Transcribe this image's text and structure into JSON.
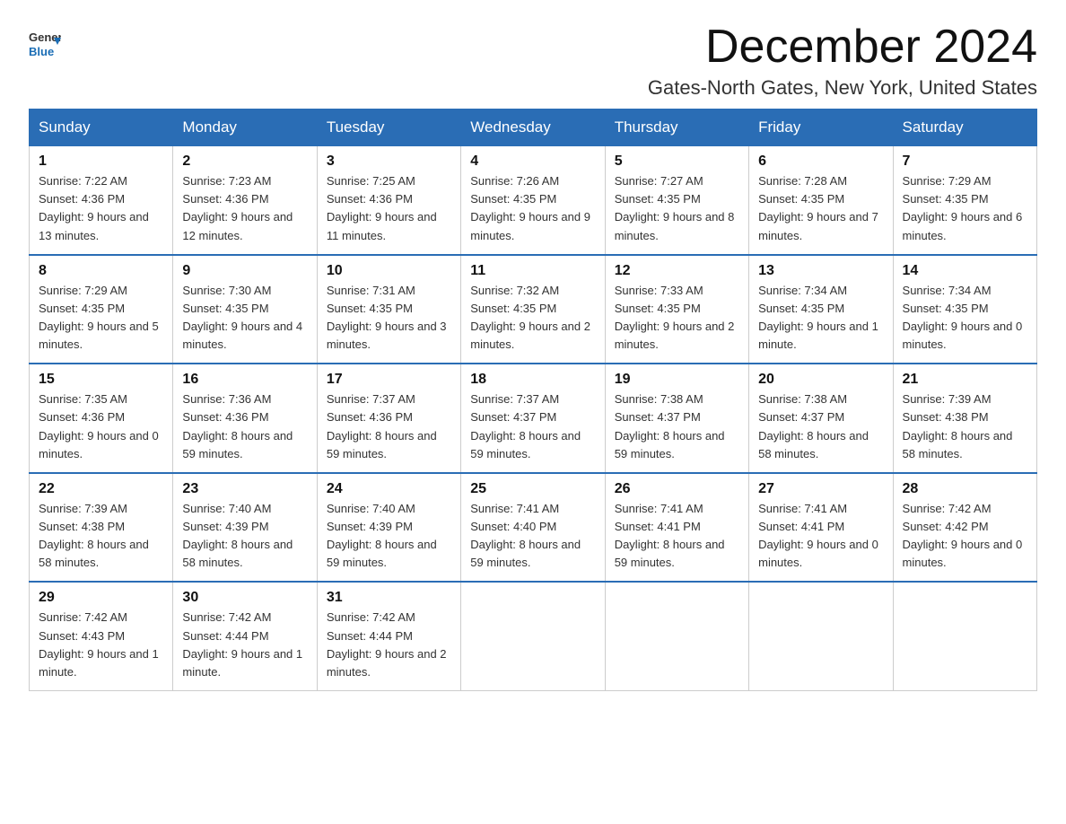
{
  "header": {
    "logo_general": "General",
    "logo_blue": "Blue",
    "month_title": "December 2024",
    "subtitle": "Gates-North Gates, New York, United States"
  },
  "days_of_week": [
    "Sunday",
    "Monday",
    "Tuesday",
    "Wednesday",
    "Thursday",
    "Friday",
    "Saturday"
  ],
  "weeks": [
    [
      {
        "day": "1",
        "sunrise": "7:22 AM",
        "sunset": "4:36 PM",
        "daylight": "9 hours and 13 minutes."
      },
      {
        "day": "2",
        "sunrise": "7:23 AM",
        "sunset": "4:36 PM",
        "daylight": "9 hours and 12 minutes."
      },
      {
        "day": "3",
        "sunrise": "7:25 AM",
        "sunset": "4:36 PM",
        "daylight": "9 hours and 11 minutes."
      },
      {
        "day": "4",
        "sunrise": "7:26 AM",
        "sunset": "4:35 PM",
        "daylight": "9 hours and 9 minutes."
      },
      {
        "day": "5",
        "sunrise": "7:27 AM",
        "sunset": "4:35 PM",
        "daylight": "9 hours and 8 minutes."
      },
      {
        "day": "6",
        "sunrise": "7:28 AM",
        "sunset": "4:35 PM",
        "daylight": "9 hours and 7 minutes."
      },
      {
        "day": "7",
        "sunrise": "7:29 AM",
        "sunset": "4:35 PM",
        "daylight": "9 hours and 6 minutes."
      }
    ],
    [
      {
        "day": "8",
        "sunrise": "7:29 AM",
        "sunset": "4:35 PM",
        "daylight": "9 hours and 5 minutes."
      },
      {
        "day": "9",
        "sunrise": "7:30 AM",
        "sunset": "4:35 PM",
        "daylight": "9 hours and 4 minutes."
      },
      {
        "day": "10",
        "sunrise": "7:31 AM",
        "sunset": "4:35 PM",
        "daylight": "9 hours and 3 minutes."
      },
      {
        "day": "11",
        "sunrise": "7:32 AM",
        "sunset": "4:35 PM",
        "daylight": "9 hours and 2 minutes."
      },
      {
        "day": "12",
        "sunrise": "7:33 AM",
        "sunset": "4:35 PM",
        "daylight": "9 hours and 2 minutes."
      },
      {
        "day": "13",
        "sunrise": "7:34 AM",
        "sunset": "4:35 PM",
        "daylight": "9 hours and 1 minute."
      },
      {
        "day": "14",
        "sunrise": "7:34 AM",
        "sunset": "4:35 PM",
        "daylight": "9 hours and 0 minutes."
      }
    ],
    [
      {
        "day": "15",
        "sunrise": "7:35 AM",
        "sunset": "4:36 PM",
        "daylight": "9 hours and 0 minutes."
      },
      {
        "day": "16",
        "sunrise": "7:36 AM",
        "sunset": "4:36 PM",
        "daylight": "8 hours and 59 minutes."
      },
      {
        "day": "17",
        "sunrise": "7:37 AM",
        "sunset": "4:36 PM",
        "daylight": "8 hours and 59 minutes."
      },
      {
        "day": "18",
        "sunrise": "7:37 AM",
        "sunset": "4:37 PM",
        "daylight": "8 hours and 59 minutes."
      },
      {
        "day": "19",
        "sunrise": "7:38 AM",
        "sunset": "4:37 PM",
        "daylight": "8 hours and 59 minutes."
      },
      {
        "day": "20",
        "sunrise": "7:38 AM",
        "sunset": "4:37 PM",
        "daylight": "8 hours and 58 minutes."
      },
      {
        "day": "21",
        "sunrise": "7:39 AM",
        "sunset": "4:38 PM",
        "daylight": "8 hours and 58 minutes."
      }
    ],
    [
      {
        "day": "22",
        "sunrise": "7:39 AM",
        "sunset": "4:38 PM",
        "daylight": "8 hours and 58 minutes."
      },
      {
        "day": "23",
        "sunrise": "7:40 AM",
        "sunset": "4:39 PM",
        "daylight": "8 hours and 58 minutes."
      },
      {
        "day": "24",
        "sunrise": "7:40 AM",
        "sunset": "4:39 PM",
        "daylight": "8 hours and 59 minutes."
      },
      {
        "day": "25",
        "sunrise": "7:41 AM",
        "sunset": "4:40 PM",
        "daylight": "8 hours and 59 minutes."
      },
      {
        "day": "26",
        "sunrise": "7:41 AM",
        "sunset": "4:41 PM",
        "daylight": "8 hours and 59 minutes."
      },
      {
        "day": "27",
        "sunrise": "7:41 AM",
        "sunset": "4:41 PM",
        "daylight": "9 hours and 0 minutes."
      },
      {
        "day": "28",
        "sunrise": "7:42 AM",
        "sunset": "4:42 PM",
        "daylight": "9 hours and 0 minutes."
      }
    ],
    [
      {
        "day": "29",
        "sunrise": "7:42 AM",
        "sunset": "4:43 PM",
        "daylight": "9 hours and 1 minute."
      },
      {
        "day": "30",
        "sunrise": "7:42 AM",
        "sunset": "4:44 PM",
        "daylight": "9 hours and 1 minute."
      },
      {
        "day": "31",
        "sunrise": "7:42 AM",
        "sunset": "4:44 PM",
        "daylight": "9 hours and 2 minutes."
      },
      null,
      null,
      null,
      null
    ]
  ]
}
